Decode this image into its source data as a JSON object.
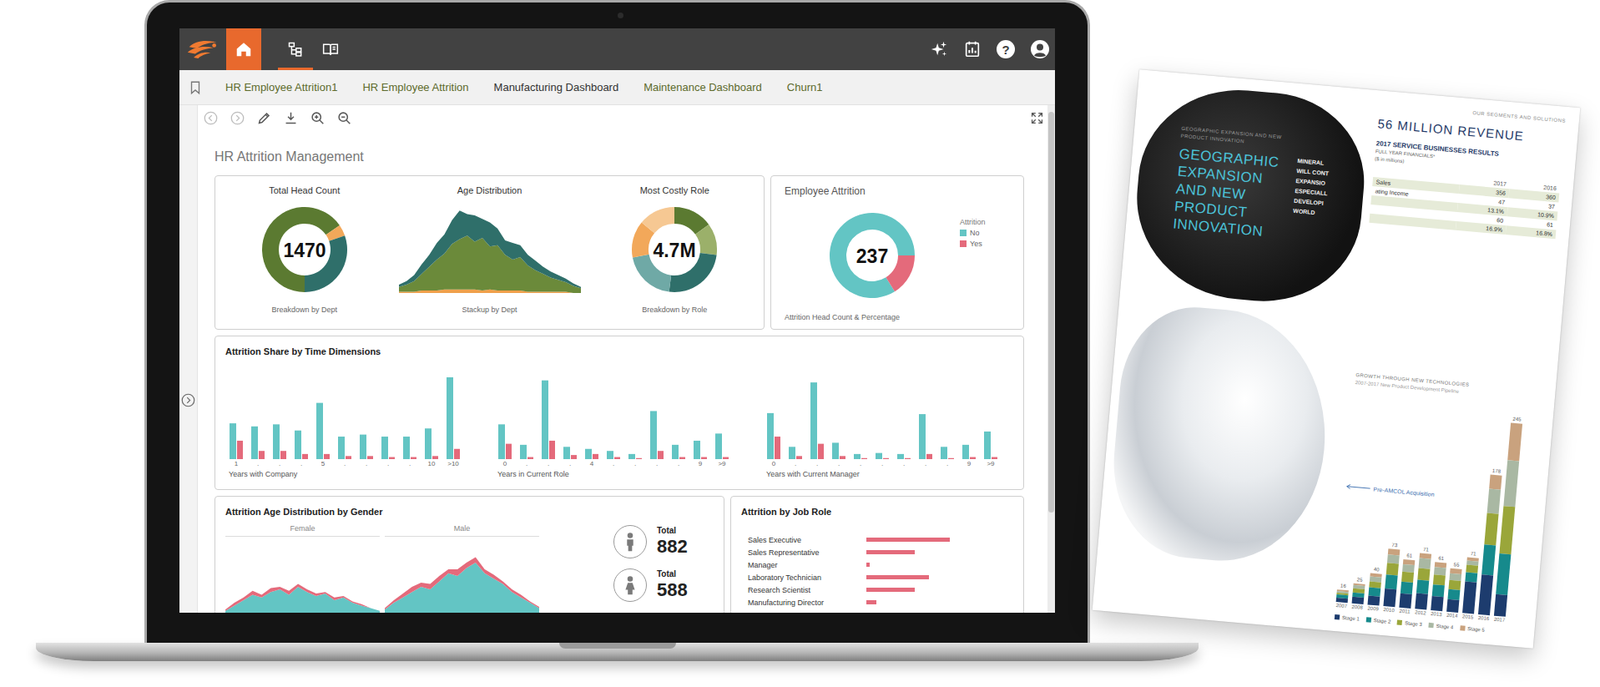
{
  "app_bar": {
    "home": {
      "selected": true
    },
    "nav_buttons": [
      {
        "kind": "tree",
        "selected": true
      },
      {
        "kind": "book",
        "selected": false
      }
    ],
    "actions": [
      {
        "kind": "sparkle"
      },
      {
        "kind": "report"
      },
      {
        "kind": "help",
        "glyph": "?"
      },
      {
        "kind": "user"
      }
    ]
  },
  "tabs": [
    {
      "label": "HR Employee Attrition1",
      "selected": false
    },
    {
      "label": "HR Employee Attrition",
      "selected": false
    },
    {
      "label": "Manufacturing Dashboard",
      "selected": true
    },
    {
      "label": "Maintenance Dashboard",
      "selected": false
    },
    {
      "label": "Churn1",
      "selected": false
    }
  ],
  "toolbar": {
    "tools": [
      {
        "kind": "back",
        "disabled": true
      },
      {
        "kind": "forward",
        "disabled": true
      },
      {
        "kind": "edit",
        "disabled": false
      },
      {
        "kind": "download",
        "disabled": false
      },
      {
        "kind": "zoom-in",
        "disabled": false
      },
      {
        "kind": "zoom-out",
        "disabled": false
      },
      {
        "kind": "expand",
        "disabled": false
      }
    ]
  },
  "sidebar": {
    "expanded": false
  },
  "scrollbar": {
    "level": 0.8
  },
  "dashboard": {
    "title": "HR Attrition Management",
    "summary": {
      "charts": [
        {
          "kind": "donut",
          "title": "Total Head Count",
          "value": "1470",
          "caption": "Breakdown by Dept",
          "segments": [
            {
              "value": 961,
              "color": "#5b7a31"
            },
            {
              "value": 63,
              "color": "#f2a85a"
            },
            {
              "value": 446,
              "color": "#2f6f6a"
            }
          ]
        },
        {
          "kind": "area",
          "title": "Age Distribution",
          "caption": "Stackup by Dept",
          "series": [
            {
              "color": "#f0a04b",
              "values": [
                1,
                1,
                1,
                2,
                2,
                2,
                3,
                3,
                3,
                3,
                3,
                2,
                3,
                2,
                2,
                2,
                2,
                1,
                1,
                1,
                1,
                1,
                1,
                0,
                0
              ]
            },
            {
              "color": "#6b8a3a",
              "values": [
                4,
                6,
                9,
                14,
                20,
                26,
                30,
                38,
                42,
                45,
                40,
                44,
                36,
                38,
                30,
                26,
                28,
                22,
                18,
                15,
                12,
                10,
                8,
                6,
                4
              ]
            },
            {
              "color": "#2f6f6a",
              "values": [
                2,
                3,
                5,
                8,
                10,
                14,
                16,
                20,
                24,
                18,
                22,
                16,
                20,
                14,
                12,
                14,
                10,
                9,
                8,
                6,
                5,
                4,
                3,
                2,
                1
              ]
            }
          ]
        },
        {
          "kind": "donut",
          "title": "Most Costly Role",
          "value": "4.7M",
          "caption": "Breakdown by Role",
          "segments": [
            {
              "value": 15,
              "color": "#5b7a31"
            },
            {
              "value": 12,
              "color": "#9bb06a"
            },
            {
              "value": 25,
              "color": "#2f6f6a"
            },
            {
              "value": 20,
              "color": "#6fa9a6"
            },
            {
              "value": 14,
              "color": "#f2a85a"
            },
            {
              "value": 14,
              "color": "#f6c893"
            }
          ]
        }
      ]
    },
    "attrition": {
      "title": "Employee Attrition",
      "value": "237",
      "caption": "Attrition Head Count & Percentage",
      "legend_title": "Attrition",
      "segments": [
        {
          "label": "No",
          "value": 1233,
          "color": "#63c5c4"
        },
        {
          "label": "Yes",
          "value": 237,
          "color": "#e46a7b"
        }
      ]
    },
    "time": {
      "title": "Attrition Share by Time Dimensions",
      "groups": [
        {
          "caption": "Years with Company",
          "labels": [
            "1",
            ".",
            ".",
            ".",
            "5",
            ".",
            ".",
            ".",
            ".",
            "10",
            ">10"
          ],
          "series": [
            {
              "color": "#63c5c4",
              "values": [
                35,
                32,
                34,
                28,
                55,
                22,
                24,
                22,
                22,
                30,
                80
              ]
            },
            {
              "color": "#e46a7b",
              "values": [
                18,
                8,
                8,
                5,
                5,
                3,
                3,
                2,
                2,
                3,
                10
              ]
            }
          ]
        },
        {
          "caption": "Years in Current Role",
          "labels": [
            "0",
            ".",
            ".",
            ".",
            "4",
            ".",
            ".",
            ".",
            ".",
            "9",
            ">9"
          ],
          "series": [
            {
              "color": "#63c5c4",
              "values": [
                34,
                14,
                77,
                12,
                10,
                8,
                5,
                47,
                14,
                18,
                25
              ]
            },
            {
              "color": "#e46a7b",
              "values": [
                15,
                2,
                18,
                4,
                5,
                2,
                1,
                8,
                2,
                2,
                2
              ]
            }
          ]
        },
        {
          "caption": "Years with Current Manager",
          "labels": [
            "0",
            ".",
            ".",
            ".",
            ".",
            ".",
            ".",
            ".",
            ".",
            "9",
            ">9"
          ],
          "series": [
            {
              "color": "#63c5c4",
              "values": [
                45,
                12,
                75,
                16,
                5,
                6,
                5,
                44,
                12,
                14,
                27
              ]
            },
            {
              "color": "#e46a7b",
              "values": [
                22,
                3,
                15,
                3,
                1,
                1,
                1,
                5,
                1,
                2,
                2
              ]
            }
          ]
        }
      ]
    },
    "gender": {
      "title": "Attrition Age Distribution by Gender",
      "panels": [
        {
          "label": "Female",
          "series": [
            {
              "color": "#63c5c4",
              "values": [
                2,
                6,
                10,
                14,
                12,
                16,
                18,
                14,
                20,
                16,
                13,
                15,
                10,
                12,
                8,
                6,
                4,
                2
              ]
            },
            {
              "color": "#e46a7b",
              "values": [
                1,
                2,
                2,
                3,
                2,
                3,
                2,
                3,
                2,
                2,
                2,
                1,
                2,
                1,
                1,
                1,
                0,
                0
              ]
            }
          ]
        },
        {
          "label": "Male",
          "series": [
            {
              "color": "#63c5c4",
              "values": [
                3,
                8,
                12,
                16,
                20,
                18,
                24,
                30,
                28,
                34,
                38,
                30,
                26,
                22,
                16,
                12,
                8,
                4
              ]
            },
            {
              "color": "#e46a7b",
              "values": [
                1,
                2,
                3,
                4,
                3,
                4,
                4,
                3,
                5,
                4,
                4,
                3,
                3,
                2,
                2,
                2,
                1,
                1
              ]
            }
          ]
        }
      ],
      "totals": [
        {
          "kind": "male",
          "label": "Total",
          "value": "882"
        },
        {
          "kind": "female",
          "label": "Total",
          "value": "588"
        }
      ]
    },
    "job_role": {
      "title": "Attrition by Job Role",
      "rows": [
        {
          "label": "Sales Executive",
          "value": 57
        },
        {
          "label": "Sales Representative",
          "value": 33
        },
        {
          "label": "Manager",
          "value": 2
        },
        {
          "label": "Laboratory Technician",
          "value": 43
        },
        {
          "label": "Research Scientist",
          "value": 33
        },
        {
          "label": "Manufacturing Director",
          "value": 7
        }
      ]
    }
  },
  "brochure": {
    "kicker": "GEOGRAPHIC EXPANSION AND NEW PRODUCT INNOVATION",
    "headline": "GEOGRAPHIC EXPANSION AND NEW PRODUCT INNOVATION",
    "curl_lines": [
      "MINERAL",
      "WILL CONT",
      "EXPANSIO",
      "ESPECIALL",
      "DEVELOPI",
      "WORLD"
    ],
    "section": "OUR SEGMENTS AND SOLUTIONS",
    "revenue": "56 MILLION REVENUE",
    "results_title": "2017 SERVICE BUSINESSES RESULTS",
    "results_sub": "FULL YEAR FINANCIALS*",
    "results_unit": "($ in millions)",
    "table": {
      "columns": [
        "",
        "2017",
        "2016"
      ],
      "rows": [
        [
          "Sales",
          "356",
          "360"
        ],
        [
          "ating Income",
          "47",
          "37"
        ],
        [
          "",
          "13.1%",
          "10.9%"
        ],
        [
          "",
          "60",
          "61"
        ],
        [
          "",
          "16.9%",
          "16.8%"
        ]
      ]
    },
    "chart": {
      "title": "GROWTH THROUGH NEW TECHNOLOGIES",
      "subtitle": "2007-2017 New Product Development Pipeline",
      "annotation": "Pre-AMCOL Acquisition",
      "years": [
        "2007",
        "2008",
        "2009",
        "2010",
        "2011",
        "2012",
        "2013",
        "2014",
        "2015",
        "2016",
        "2017"
      ],
      "totals": [
        "16",
        "25",
        "40",
        "73",
        "61",
        "71",
        "61",
        "55",
        "71",
        "178",
        "245"
      ],
      "stages": [
        {
          "label": "Stage 1",
          "color": "#1d3c6e",
          "values": [
            5,
            8,
            12,
            22,
            18,
            20,
            18,
            16,
            40,
            51,
            28
          ]
        },
        {
          "label": "Stage 2",
          "color": "#168a8c",
          "values": [
            4,
            6,
            10,
            18,
            15,
            17,
            15,
            13,
            12,
            38,
            51
          ]
        },
        {
          "label": "Stage 3",
          "color": "#9aa63a",
          "values": [
            3,
            5,
            8,
            15,
            12,
            15,
            12,
            11,
            9,
            40,
            60
          ]
        },
        {
          "label": "Stage 4",
          "color": "#a9b8a3",
          "values": [
            2,
            4,
            6,
            11,
            10,
            12,
            10,
            9,
            6,
            31,
            58
          ]
        },
        {
          "label": "Stage 5",
          "color": "#c9a27e",
          "values": [
            2,
            2,
            4,
            7,
            6,
            7,
            6,
            6,
            4,
            18,
            48
          ]
        }
      ]
    }
  }
}
